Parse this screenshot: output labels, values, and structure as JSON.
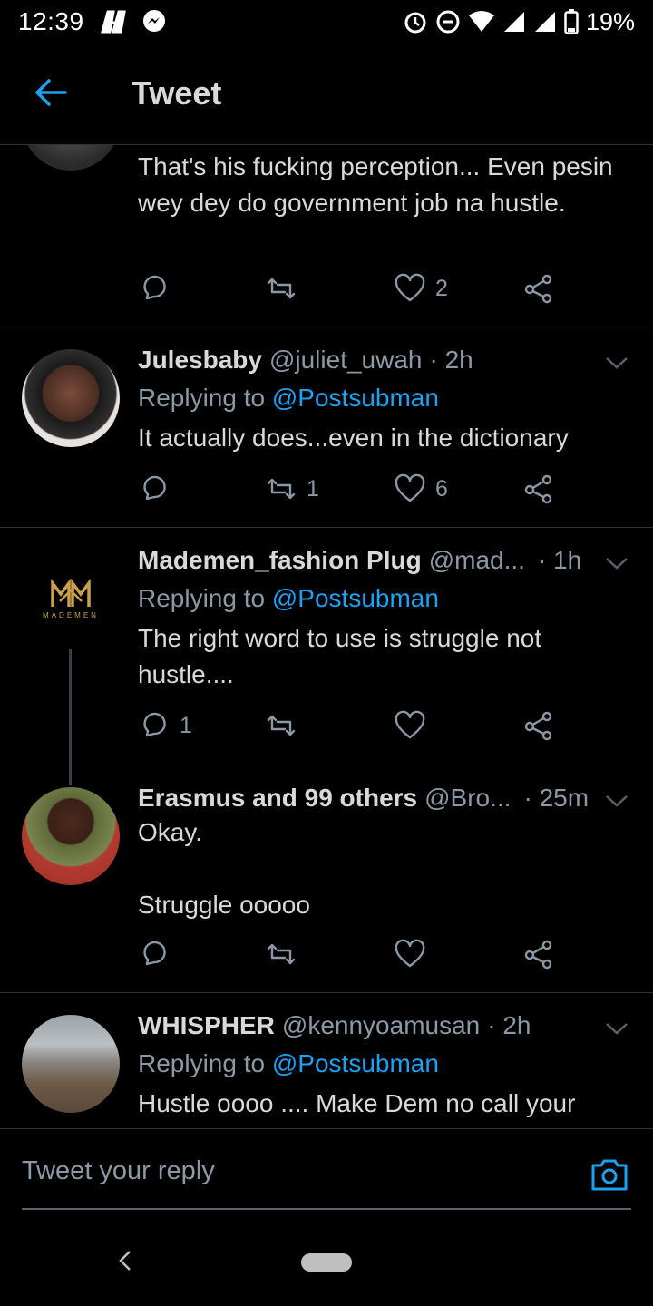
{
  "status_bar": {
    "time": "12:39",
    "left_icons": [
      "netflix-icon",
      "messenger-icon"
    ],
    "right_icons": [
      "alarm-icon",
      "dnd-icon",
      "wifi-icon",
      "signal-icon",
      "signal-icon",
      "battery-icon"
    ],
    "battery_pct": "19%"
  },
  "header": {
    "title": "Tweet",
    "accent": "#1da1f2"
  },
  "tweets": [
    {
      "name": "",
      "handle": "",
      "time": "",
      "text": "That's his fucking perception... Even pesin wey dey do government job na hustle.",
      "replies": "",
      "retweets": "",
      "likes": "2"
    },
    {
      "name": "Julesbaby",
      "handle": "@juliet_uwah",
      "time": "· 2h",
      "reply_prefix": "Replying to ",
      "reply_to": "@Postsubman",
      "text": "It actually does...even in the dictionary",
      "replies": "",
      "retweets": "1",
      "likes": "6"
    },
    {
      "name": "Mademen_fashion Plug",
      "handle": "@mad...",
      "time": "· 1h",
      "reply_prefix": "Replying to ",
      "reply_to": "@Postsubman",
      "text": "The right word to use is struggle not hustle....",
      "logo_text": "MADEMEN",
      "replies": "1",
      "retweets": "",
      "likes": ""
    },
    {
      "name": "Erasmus and 99 others",
      "handle": "@Bro...",
      "time": "· 25m",
      "text": "Okay.\n\nStruggle ooooo",
      "replies": "",
      "retweets": "",
      "likes": ""
    },
    {
      "name": "WHISPHER",
      "handle": "@kennyoamusan",
      "time": "· 2h",
      "reply_prefix": "Replying to ",
      "reply_to": "@Postsubman",
      "text": "Hustle oooo .... Make Dem no call your"
    }
  ],
  "reply_bar": {
    "placeholder": "Tweet your reply"
  }
}
